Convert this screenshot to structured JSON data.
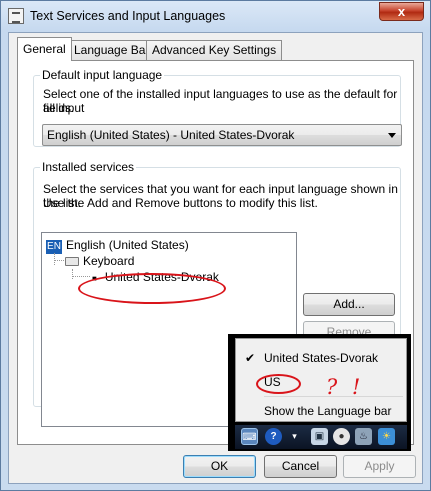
{
  "window": {
    "title": "Text Services and Input Languages",
    "close_glyph": "x"
  },
  "tabs": [
    {
      "label": "General"
    },
    {
      "label": "Language Bar"
    },
    {
      "label": "Advanced Key Settings"
    }
  ],
  "default_input": {
    "group_title": "Default input language",
    "desc_line1": "Select one of the installed input languages to use as the default for all input",
    "desc_line2": "fields.",
    "selected": "English (United States) - United States-Dvorak"
  },
  "installed": {
    "group_title": "Installed services",
    "desc_line1": "Select the services that you want for each input language shown in the list.",
    "desc_line2": "Use the Add and Remove buttons to modify this list.",
    "tree": {
      "lang_badge": "EN",
      "language": "English (United States)",
      "category": "Keyboard",
      "layout": "United States-Dvorak"
    },
    "add_label": "Add...",
    "remove_label": "Remove"
  },
  "footer": {
    "ok_label": "OK",
    "cancel_label": "Cancel",
    "apply_label": "Apply"
  },
  "language_menu": {
    "items": [
      {
        "label": "United States-Dvorak",
        "checked": true
      },
      {
        "label": "US",
        "checked": false
      },
      {
        "label": "Show the Language bar",
        "checked": false
      }
    ],
    "annotation": "? !",
    "tray_icons": [
      "keyboard-icon",
      "help-icon",
      "language-bar-options-icon",
      "network-icon",
      "media-icon",
      "steam-icon",
      "weather-icon"
    ]
  },
  "colors": {
    "annotation_red": "#d9141a",
    "lang_badge_blue": "#1a5fb4"
  }
}
